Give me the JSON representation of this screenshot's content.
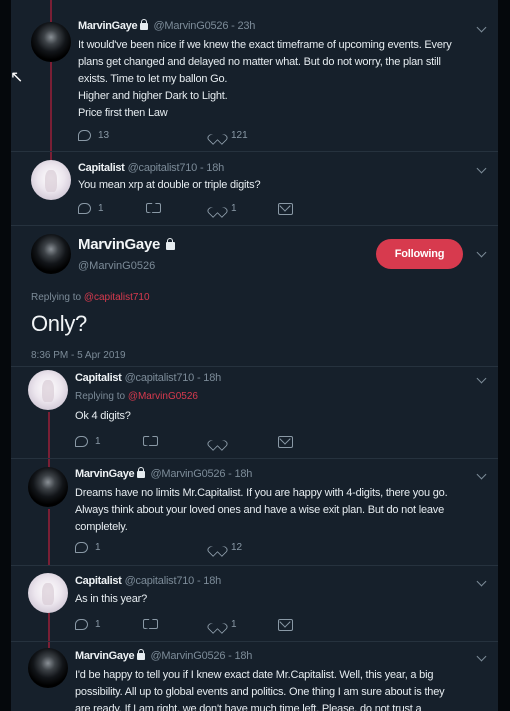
{
  "tweets": [
    {
      "name": "MarvinGaye",
      "handle": "@MarvinG0526",
      "time": "23h",
      "lines": [
        "It would've been nice if we knew the exact timeframe of upcoming events. Every",
        "plans get changed and delayed no matter what. But do not worry, the plan still",
        "exists. Time to let my ballon Go.",
        "Higher and higher Dark to Light.",
        "Price first then Law"
      ],
      "replies": "13",
      "likes": "121"
    },
    {
      "name": "Capitalist",
      "handle": "@capitalist710",
      "time": "18h",
      "lines": [
        "You mean xrp at double or triple digits?"
      ],
      "replies": "1",
      "likes": "1"
    }
  ],
  "focus": {
    "name": "MarvinGaye",
    "handle": "@MarvinG0526",
    "follow_label": "Following",
    "replying_prefix": "Replying to",
    "replying_to": "@capitalist710",
    "text": "Only?",
    "timestamp": "8:36 PM - 5 Apr 2019"
  },
  "replies": [
    {
      "name": "Capitalist",
      "handle": "@capitalist710",
      "time": "18h",
      "replying_prefix": "Replying to",
      "replying_to": "@MarvinG0526",
      "lines": [
        "Ok 4 digits?"
      ],
      "replies": "1",
      "likes": ""
    },
    {
      "name": "MarvinGaye",
      "handle": "@MarvinG0526",
      "time": "18h",
      "lines": [
        "Dreams have no limits Mr.Capitalist. If you are happy with 4-digits, there you go.",
        "Always think about your loved ones and have a wise exit plan. But do not leave",
        "completely."
      ],
      "replies": "1",
      "likes": "12"
    },
    {
      "name": "Capitalist",
      "handle": "@capitalist710",
      "time": "18h",
      "lines": [
        "As in this year?"
      ],
      "replies": "1",
      "likes": "1"
    },
    {
      "name": "MarvinGaye",
      "handle": "@MarvinG0526",
      "time": "18h",
      "lines": [
        "I'd be happy to tell you if I knew exact date Mr.Capitalist. Well, this year, a big",
        "possibility. All up to global events and politics. One thing I am sure about is they",
        "are ready. If I am right, we don't have much time left. Please, do not trust a"
      ]
    }
  ],
  "separator": " - ",
  "colors": {
    "background": "#16202b",
    "accent": "#d73a4e",
    "thread_line": "#7a1f35",
    "muted_text": "#7c8b98"
  },
  "icons": [
    "reply-icon",
    "retweet-icon",
    "like-icon",
    "direct-message-icon",
    "lock-icon",
    "chevron-down-icon"
  ]
}
